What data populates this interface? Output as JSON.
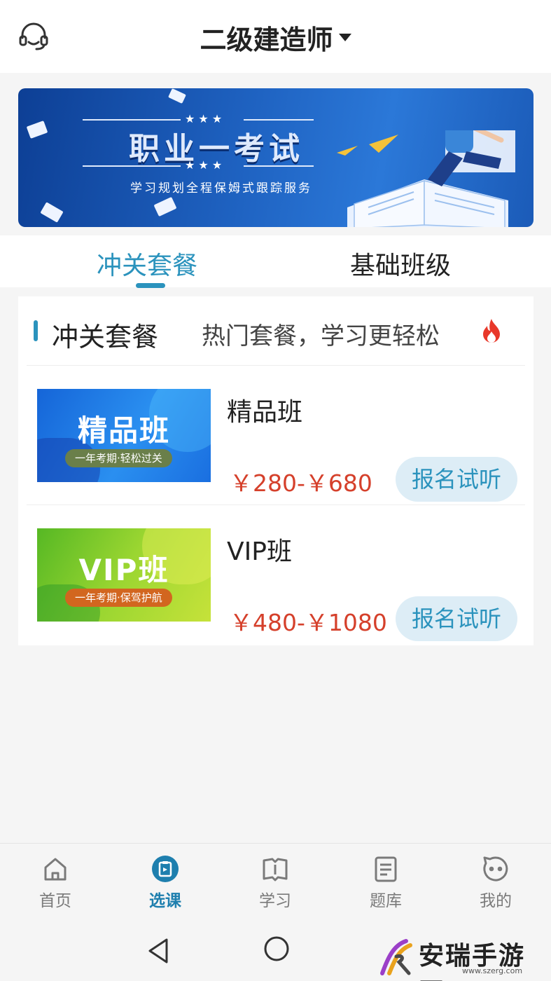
{
  "header": {
    "title": "二级建造师",
    "support_icon": "headset-icon",
    "dropdown_icon": "caret-down-icon"
  },
  "banner": {
    "title": "职业一考试",
    "subtitle": "学习规划全程保姆式跟踪服务",
    "stars": "★ ★ ★"
  },
  "tabs": [
    {
      "label": "冲关套餐",
      "active": true
    },
    {
      "label": "基础班级",
      "active": false
    }
  ],
  "section": {
    "title": "冲关套餐",
    "subtitle": "热门套餐，学习更轻松",
    "icon": "fire-icon"
  },
  "courses": [
    {
      "name": "精品班",
      "image_title": "精品班",
      "image_tag": "一年考期·轻松过关",
      "price": "￥280-￥680",
      "button": "报名试听"
    },
    {
      "name": "VIP班",
      "image_title": "VIP班",
      "image_tag": "一年考期·保驾护航",
      "price": "￥480-￥1080",
      "button": "报名试听"
    }
  ],
  "bottom_nav": [
    {
      "label": "首页",
      "icon": "home-icon",
      "active": false
    },
    {
      "label": "选课",
      "icon": "course-select-icon",
      "active": true
    },
    {
      "label": "学习",
      "icon": "book-icon",
      "active": false
    },
    {
      "label": "题库",
      "icon": "question-bank-icon",
      "active": false
    },
    {
      "label": "我的",
      "icon": "profile-icon",
      "active": false
    }
  ],
  "watermark": {
    "text": "安瑞手游网",
    "url": "www.szerg.com"
  },
  "colors": {
    "accent": "#2b93bd",
    "price": "#d5402b",
    "button_bg": "#ddedf6",
    "background": "#f5f5f5"
  }
}
